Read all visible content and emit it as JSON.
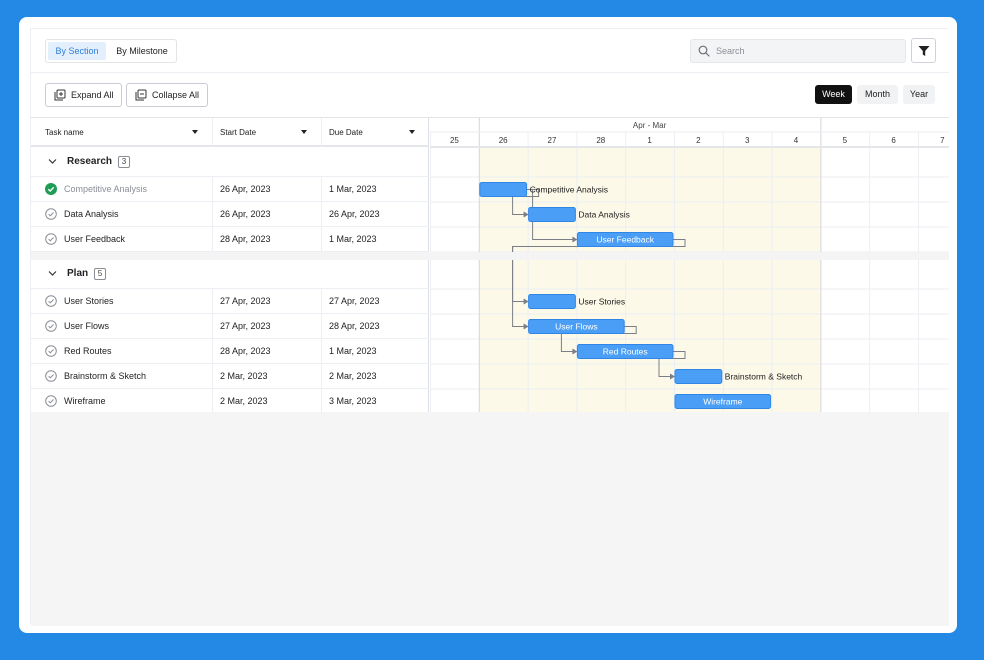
{
  "toolbar": {
    "group_tabs": [
      {
        "label": "By Section",
        "active": true
      },
      {
        "label": "By Milestone",
        "active": false
      }
    ],
    "search_placeholder": "Search",
    "filter_icon": "filter-icon",
    "expand_all": "Expand All",
    "collapse_all": "Collapse All",
    "views": [
      {
        "label": "Week",
        "active": true
      },
      {
        "label": "Month",
        "active": false
      },
      {
        "label": "Year",
        "active": false
      }
    ]
  },
  "columns": {
    "task_name": "Task name",
    "start_date": "Start Date",
    "due_date": "Due Date"
  },
  "timeline": {
    "range_label": "Apr - Mar",
    "days": [
      "25",
      "26",
      "27",
      "28",
      "1",
      "2",
      "3",
      "4",
      "5",
      "6",
      "7"
    ],
    "highlight_days": [
      "26",
      "27",
      "28",
      "1",
      "2",
      "3",
      "4"
    ]
  },
  "sections": [
    {
      "title": "Research",
      "count": "3",
      "tasks": [
        {
          "name": "Competitive Analysis",
          "start": "26 Apr, 2023",
          "due": "1 Mar, 2023",
          "done": true
        },
        {
          "name": "Data Analysis",
          "start": "26 Apr, 2023",
          "due": "26 Apr, 2023",
          "done": false
        },
        {
          "name": "User Feedback",
          "start": "28 Apr, 2023",
          "due": "1 Mar, 2023",
          "done": false
        }
      ]
    },
    {
      "title": "Plan",
      "count": "5",
      "tasks": [
        {
          "name": "User Stories",
          "start": "27 Apr, 2023",
          "due": "27 Apr, 2023",
          "done": false
        },
        {
          "name": "User Flows",
          "start": "27 Apr, 2023",
          "due": "28 Apr, 2023",
          "done": false
        },
        {
          "name": "Red Routes",
          "start": "28 Apr, 2023",
          "due": "1 Mar, 2023",
          "done": false
        },
        {
          "name": "Brainstorm & Sketch",
          "start": "2 Mar, 2023",
          "due": "2 Mar, 2023",
          "done": false
        },
        {
          "name": "Wireframe",
          "start": "2 Mar, 2023",
          "due": "3 Mar, 2023",
          "done": false
        }
      ]
    }
  ],
  "gantt": [
    {
      "task": "Competitive Analysis",
      "start_day": "26",
      "end_day": "26",
      "label_inside": false
    },
    {
      "task": "Data Analysis",
      "start_day": "27",
      "end_day": "27",
      "label_inside": false
    },
    {
      "task": "User Feedback",
      "start_day": "28",
      "end_day": "1",
      "label_inside": true
    },
    {
      "task": "User Stories",
      "start_day": "27",
      "end_day": "27",
      "label_inside": false
    },
    {
      "task": "User Flows",
      "start_day": "27",
      "end_day": "28",
      "label_inside": true
    },
    {
      "task": "Red Routes",
      "start_day": "28",
      "end_day": "1",
      "label_inside": true
    },
    {
      "task": "Brainstorm & Sketch",
      "start_day": "2",
      "end_day": "2",
      "label_inside": false
    },
    {
      "task": "Wireframe",
      "start_day": "2",
      "end_day": "3",
      "label_inside": true
    }
  ],
  "dependencies": [
    [
      "Competitive Analysis",
      "Data Analysis"
    ],
    [
      "Competitive Analysis",
      "User Feedback"
    ],
    [
      "User Feedback",
      "User Stories"
    ],
    [
      "User Feedback",
      "User Flows"
    ],
    [
      "User Flows",
      "Red Routes"
    ],
    [
      "Red Routes",
      "Brainstorm & Sketch"
    ]
  ],
  "colors": {
    "bar": "#4A9EF5",
    "bar_border": "#2F86E6",
    "highlight": "#FDF9E8",
    "done": "#1F9D55",
    "link": "#7A7F87",
    "background": "#2489E4"
  }
}
